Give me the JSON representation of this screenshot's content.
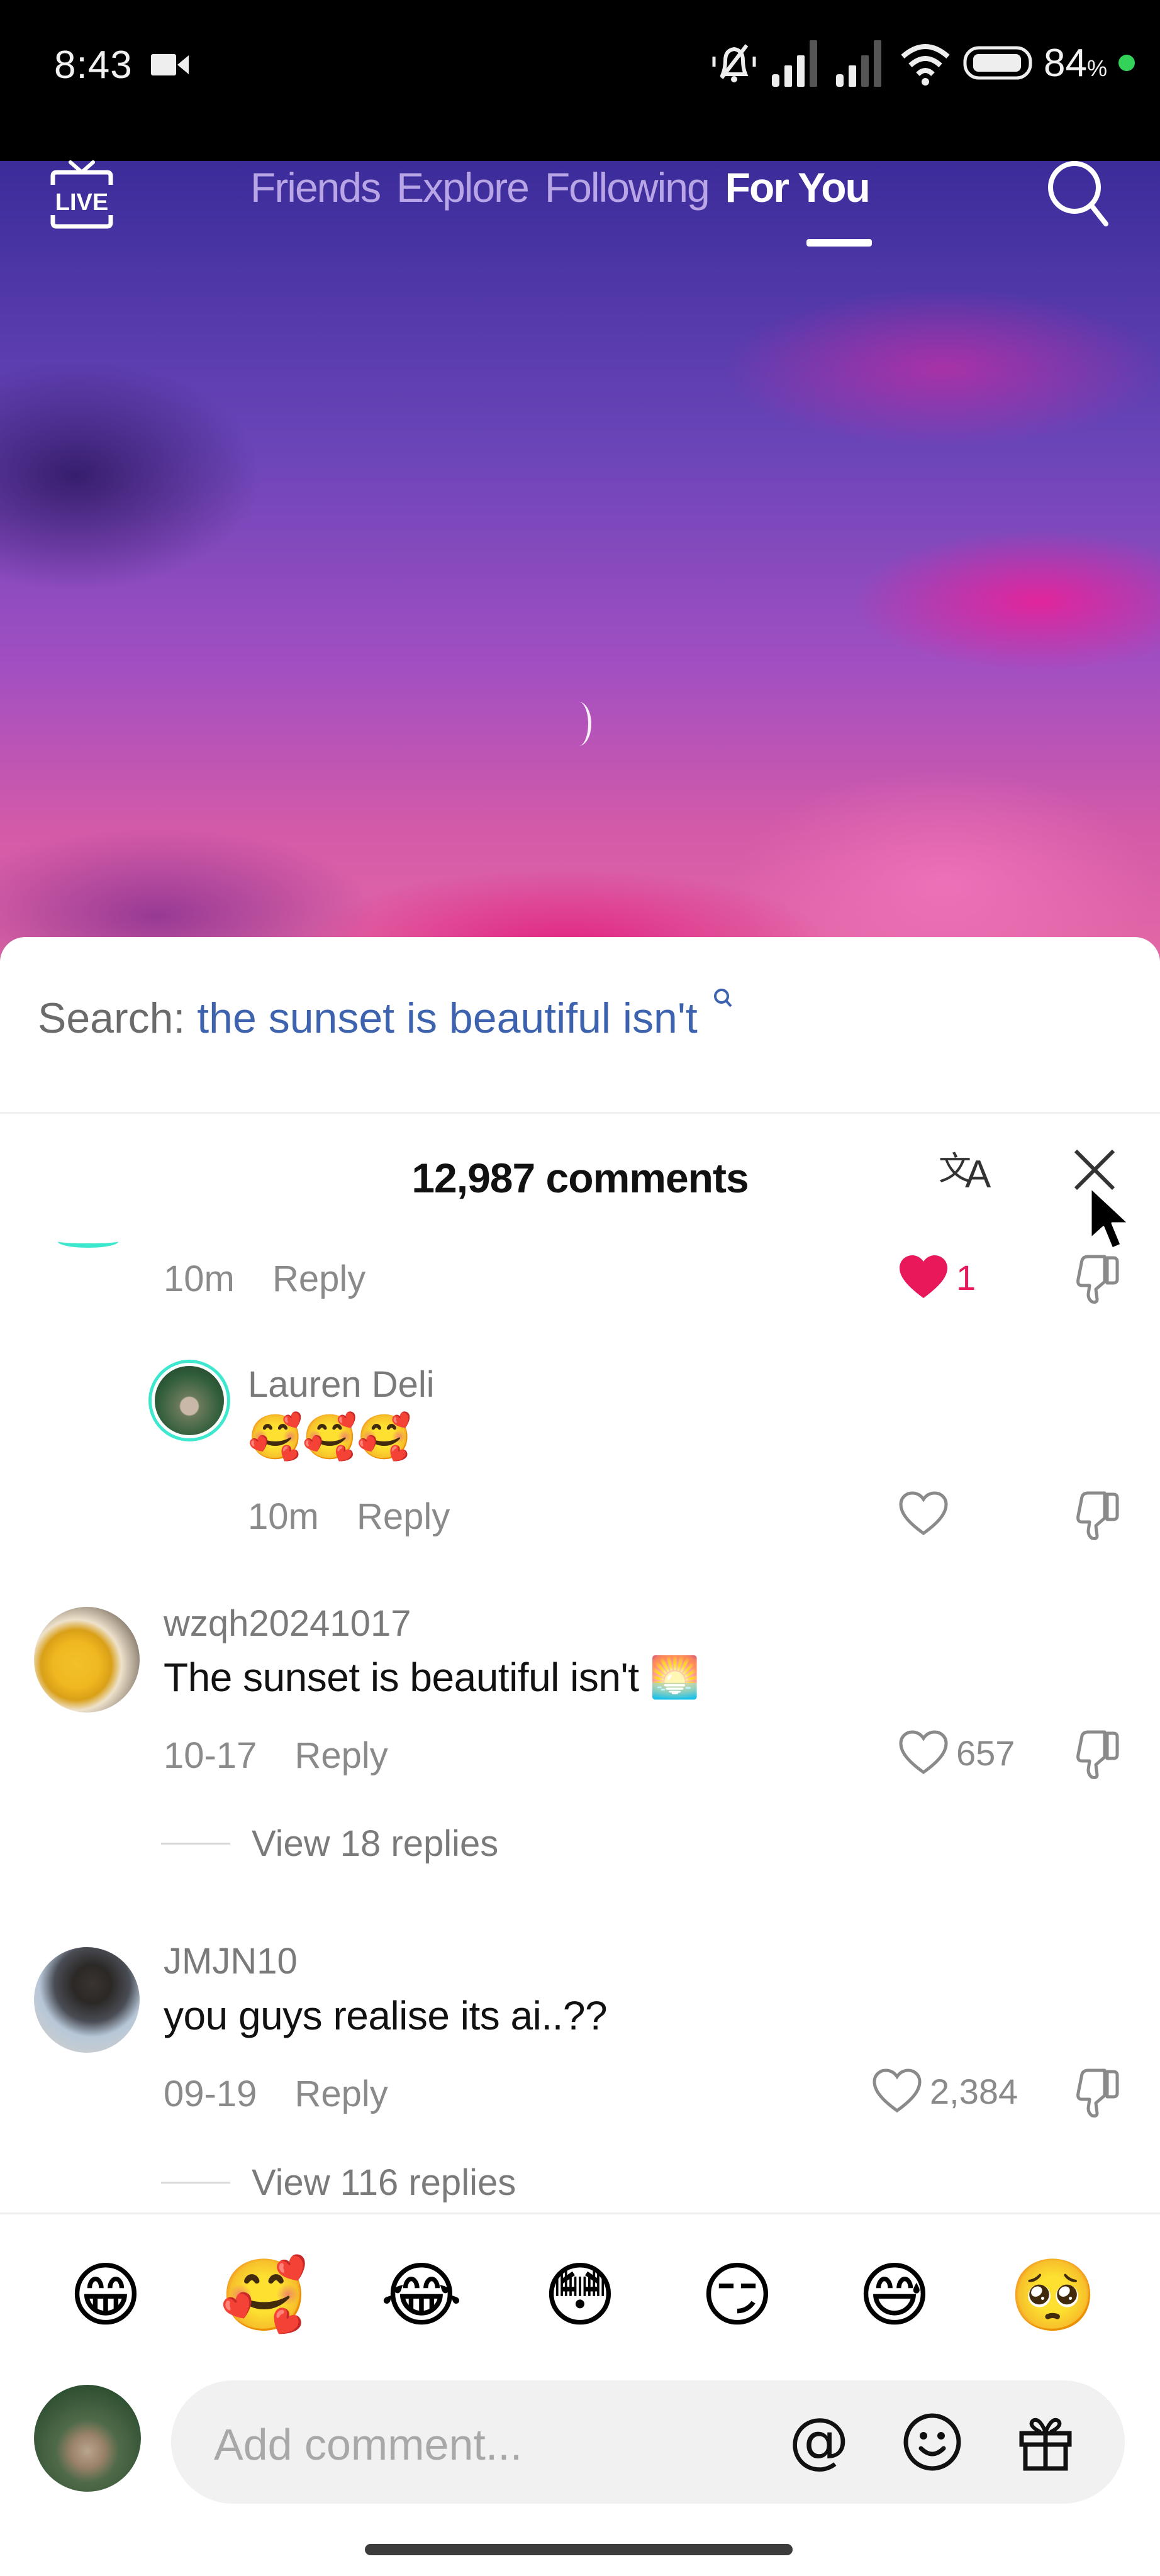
{
  "status_bar": {
    "time": "8:43",
    "battery_percent": "84",
    "battery_suffix": "%",
    "icons": [
      "video-record-icon",
      "mute-bell-icon",
      "signal-icon",
      "signal-icon",
      "wifi-icon",
      "battery-icon",
      "green-dot-indicator"
    ]
  },
  "top_nav": {
    "live_label": "LIVE",
    "tabs": [
      {
        "label": "Friends",
        "active": false
      },
      {
        "label": "Explore",
        "active": false
      },
      {
        "label": "Following",
        "active": false
      },
      {
        "label": "For You",
        "active": true
      }
    ]
  },
  "comments_sheet": {
    "search_prefix": "Search:",
    "search_term": "the sunset is beautiful isn't",
    "title": "12,987 comments",
    "comments": [
      {
        "partial": true,
        "time": "10m",
        "reply_label": "Reply",
        "likes": "1",
        "liked": true
      },
      {
        "username": "Lauren Deli",
        "text": "🥰🥰🥰",
        "time": "10m",
        "reply_label": "Reply",
        "likes": "",
        "liked": false,
        "is_reply": true
      },
      {
        "username": "wzqh20241017",
        "text": "The sunset is beautiful isn't 🌅",
        "time": "10-17",
        "reply_label": "Reply",
        "likes": "657",
        "liked": false,
        "view_replies": "View 18 replies"
      },
      {
        "username": "JMJN10",
        "text": "you guys realise its ai..??",
        "time": "09-19",
        "reply_label": "Reply",
        "likes": "2,384",
        "liked": false,
        "view_replies": "View 116 replies"
      }
    ]
  },
  "quick_emojis": [
    "😁",
    "🥰",
    "😂",
    "😳",
    "😏",
    "😅",
    "🥺"
  ],
  "composer": {
    "placeholder": "Add comment...",
    "mention_label": "@"
  },
  "colors": {
    "like_active": "#e8185a",
    "search_term": "#3d63ae",
    "avatar_ring": "#3ee8cf"
  }
}
